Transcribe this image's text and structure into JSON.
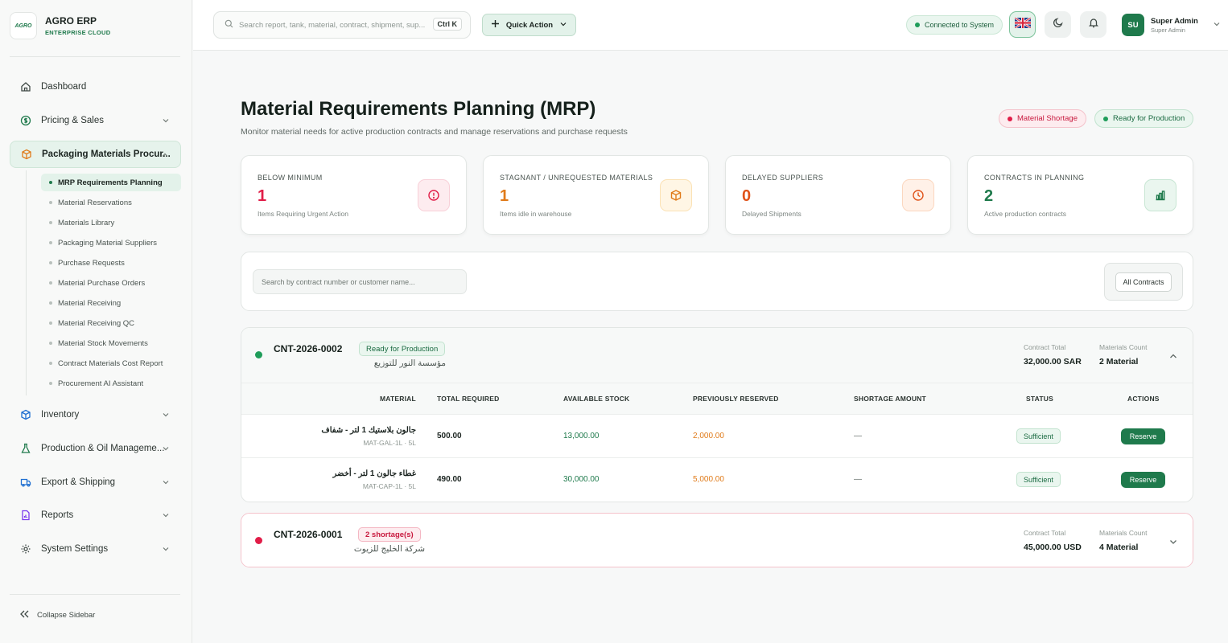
{
  "brand": {
    "logo_text": "AGRO",
    "title": "AGRO ERP",
    "subtitle": "ENTERPRISE CLOUD"
  },
  "sidebar": {
    "items": [
      {
        "label": "Dashboard",
        "icon": "home-icon"
      },
      {
        "label": "Pricing & Sales",
        "icon": "dollar-circle-icon"
      },
      {
        "label": "Packaging Materials Procur...",
        "icon": "box-icon"
      },
      {
        "label": "Inventory",
        "icon": "cube-icon"
      },
      {
        "label": "Production & Oil Manageme...",
        "icon": "flask-icon"
      },
      {
        "label": "Export & Shipping",
        "icon": "truck-icon"
      },
      {
        "label": "Reports",
        "icon": "report-icon"
      },
      {
        "label": "System Settings",
        "icon": "gear-icon"
      }
    ],
    "sub_items": [
      "MRP Requirements Planning",
      "Material Reservations",
      "Materials Library",
      "Packaging Material Suppliers",
      "Purchase Requests",
      "Material Purchase Orders",
      "Material Receiving",
      "Material Receiving QC",
      "Material Stock Movements",
      "Contract Materials Cost Report",
      "Procurement AI Assistant"
    ],
    "collapse_label": "Collapse Sidebar"
  },
  "topbar": {
    "search_placeholder": "Search report, tank, material, contract, shipment, sup...",
    "shortcut": "Ctrl K",
    "quick_action": "Quick Action",
    "connection": "Connected to System",
    "user": {
      "initials": "SU",
      "name": "Super Admin",
      "role": "Super Admin"
    }
  },
  "page": {
    "title": "Material Requirements Planning (MRP)",
    "subtitle": "Monitor material needs for active production contracts and manage reservations and purchase requests",
    "legend": {
      "shortage": "Material Shortage",
      "ready": "Ready for Production"
    }
  },
  "stats": [
    {
      "label": "BELOW MINIMUM",
      "value": "1",
      "desc": "Items Requiring Urgent Action",
      "color": "#e11d48",
      "icon": "alert-icon"
    },
    {
      "label": "STAGNANT / UNREQUESTED MATERIALS",
      "value": "1",
      "desc": "Items idle in warehouse",
      "color": "#e07b1a",
      "icon": "package-icon"
    },
    {
      "label": "DELAYED SUPPLIERS",
      "value": "0",
      "desc": "Delayed Shipments",
      "color": "#e0531a",
      "icon": "clock-icon"
    },
    {
      "label": "CONTRACTS IN PLANNING",
      "value": "2",
      "desc": "Active production contracts",
      "color": "#1f7a4c",
      "icon": "bar-chart-icon"
    }
  ],
  "filter": {
    "search_placeholder": "Search by contract number or customer name...",
    "select_value": "All Contracts"
  },
  "contracts": [
    {
      "id": "CNT-2026-0002",
      "badge": "Ready for Production",
      "customer": "مؤسسة النور للتوزيع",
      "total_label": "Contract Total",
      "total": "32,000.00 SAR",
      "count_label": "Materials Count",
      "count": "2 Material",
      "columns": [
        "MATERIAL",
        "TOTAL REQUIRED",
        "AVAILABLE STOCK",
        "PREVIOUSLY RESERVED",
        "SHORTAGE AMOUNT",
        "STATUS",
        "ACTIONS"
      ],
      "rows": [
        {
          "name": "جالون بلاستيك 1 لتر - شفاف",
          "code": "MAT-GAL-1L · 5L",
          "required": "500.00",
          "available": "13,000.00",
          "reserved": "2,000.00",
          "shortage": "—",
          "status": "Sufficient",
          "action": "Reserve"
        },
        {
          "name": "غطاء جالون 1 لتر - أخضر",
          "code": "MAT-CAP-1L · 5L",
          "required": "490.00",
          "available": "30,000.00",
          "reserved": "5,000.00",
          "shortage": "—",
          "status": "Sufficient",
          "action": "Reserve"
        }
      ]
    },
    {
      "id": "CNT-2026-0001",
      "badge": "2 shortage(s)",
      "customer": "شركة الخليج للزيوت",
      "total_label": "Contract Total",
      "total": "45,000.00 USD",
      "count_label": "Materials Count",
      "count": "4 Material"
    }
  ]
}
